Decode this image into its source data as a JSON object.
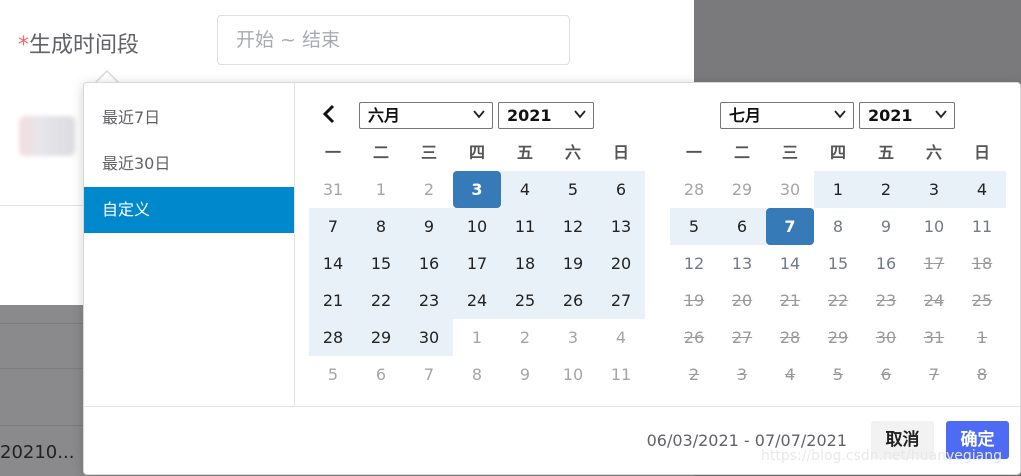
{
  "form": {
    "required_mark": "*",
    "label": "生成时间段",
    "range_placeholder": "开始 ~ 结束"
  },
  "background": {
    "table_cell": "20210..."
  },
  "shortcuts": [
    {
      "label": "最近7日",
      "active": false
    },
    {
      "label": "最近30日",
      "active": false
    },
    {
      "label": "自定义",
      "active": true
    }
  ],
  "weekdays": [
    "一",
    "二",
    "三",
    "四",
    "五",
    "六",
    "日"
  ],
  "left_calendar": {
    "month": "六月",
    "year": "2021",
    "days": [
      [
        {
          "d": "31",
          "t": "other"
        },
        {
          "d": "1",
          "t": "other"
        },
        {
          "d": "2",
          "t": "other"
        },
        {
          "d": "3",
          "t": "start"
        },
        {
          "d": "4",
          "t": "range"
        },
        {
          "d": "5",
          "t": "range"
        },
        {
          "d": "6",
          "t": "range"
        }
      ],
      [
        {
          "d": "7",
          "t": "range"
        },
        {
          "d": "8",
          "t": "range"
        },
        {
          "d": "9",
          "t": "range"
        },
        {
          "d": "10",
          "t": "range"
        },
        {
          "d": "11",
          "t": "range"
        },
        {
          "d": "12",
          "t": "range"
        },
        {
          "d": "13",
          "t": "range"
        }
      ],
      [
        {
          "d": "14",
          "t": "range"
        },
        {
          "d": "15",
          "t": "range"
        },
        {
          "d": "16",
          "t": "range"
        },
        {
          "d": "17",
          "t": "range"
        },
        {
          "d": "18",
          "t": "range"
        },
        {
          "d": "19",
          "t": "range"
        },
        {
          "d": "20",
          "t": "range"
        }
      ],
      [
        {
          "d": "21",
          "t": "range"
        },
        {
          "d": "22",
          "t": "range"
        },
        {
          "d": "23",
          "t": "range"
        },
        {
          "d": "24",
          "t": "range"
        },
        {
          "d": "25",
          "t": "range"
        },
        {
          "d": "26",
          "t": "range"
        },
        {
          "d": "27",
          "t": "range"
        }
      ],
      [
        {
          "d": "28",
          "t": "range"
        },
        {
          "d": "29",
          "t": "range"
        },
        {
          "d": "30",
          "t": "range"
        },
        {
          "d": "1",
          "t": "other"
        },
        {
          "d": "2",
          "t": "other"
        },
        {
          "d": "3",
          "t": "other"
        },
        {
          "d": "4",
          "t": "other"
        }
      ],
      [
        {
          "d": "5",
          "t": "other"
        },
        {
          "d": "6",
          "t": "other"
        },
        {
          "d": "7",
          "t": "other"
        },
        {
          "d": "8",
          "t": "other"
        },
        {
          "d": "9",
          "t": "other"
        },
        {
          "d": "10",
          "t": "other"
        },
        {
          "d": "11",
          "t": "other"
        }
      ]
    ]
  },
  "right_calendar": {
    "month": "七月",
    "year": "2021",
    "days": [
      [
        {
          "d": "28",
          "t": "other"
        },
        {
          "d": "29",
          "t": "other"
        },
        {
          "d": "30",
          "t": "other"
        },
        {
          "d": "1",
          "t": "range"
        },
        {
          "d": "2",
          "t": "range"
        },
        {
          "d": "3",
          "t": "range"
        },
        {
          "d": "4",
          "t": "range"
        }
      ],
      [
        {
          "d": "5",
          "t": "range"
        },
        {
          "d": "6",
          "t": "range"
        },
        {
          "d": "7",
          "t": "end"
        },
        {
          "d": "8",
          "t": "fut"
        },
        {
          "d": "9",
          "t": "fut"
        },
        {
          "d": "10",
          "t": "fut"
        },
        {
          "d": "11",
          "t": "fut"
        }
      ],
      [
        {
          "d": "12",
          "t": "fut"
        },
        {
          "d": "13",
          "t": "fut"
        },
        {
          "d": "14",
          "t": "fut"
        },
        {
          "d": "15",
          "t": "fut"
        },
        {
          "d": "16",
          "t": "fut"
        },
        {
          "d": "17",
          "t": "dis"
        },
        {
          "d": "18",
          "t": "dis"
        }
      ],
      [
        {
          "d": "19",
          "t": "dis"
        },
        {
          "d": "20",
          "t": "dis"
        },
        {
          "d": "21",
          "t": "dis"
        },
        {
          "d": "22",
          "t": "dis"
        },
        {
          "d": "23",
          "t": "dis"
        },
        {
          "d": "24",
          "t": "dis"
        },
        {
          "d": "25",
          "t": "dis"
        }
      ],
      [
        {
          "d": "26",
          "t": "dis"
        },
        {
          "d": "27",
          "t": "dis"
        },
        {
          "d": "28",
          "t": "dis"
        },
        {
          "d": "29",
          "t": "dis"
        },
        {
          "d": "30",
          "t": "dis"
        },
        {
          "d": "31",
          "t": "dis"
        },
        {
          "d": "1",
          "t": "dis"
        }
      ],
      [
        {
          "d": "2",
          "t": "dis"
        },
        {
          "d": "3",
          "t": "dis"
        },
        {
          "d": "4",
          "t": "dis"
        },
        {
          "d": "5",
          "t": "dis"
        },
        {
          "d": "6",
          "t": "dis"
        },
        {
          "d": "7",
          "t": "dis"
        },
        {
          "d": "8",
          "t": "dis"
        }
      ]
    ]
  },
  "footer": {
    "selected_range": "06/03/2021 - 07/07/2021",
    "cancel_label": "取消",
    "ok_label": "确定"
  },
  "watermark": "https://blog.csdn.net/huanvegiang",
  "colors": {
    "active_shortcut": "#0088cc",
    "selected_day": "#367ab8",
    "range_bg": "#e8f1f8",
    "ok_button": "#4d6cf3"
  }
}
